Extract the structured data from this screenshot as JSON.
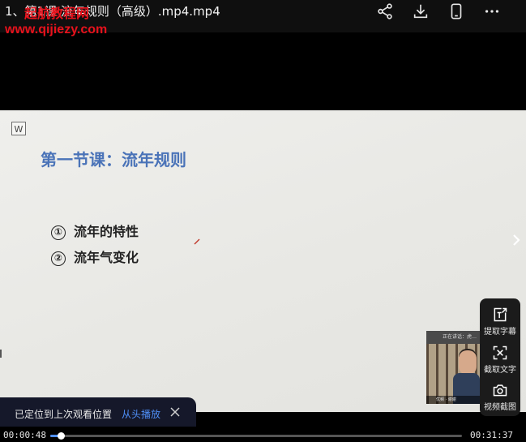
{
  "header": {
    "title": "1、第1课 流年规则（高级）.mp4.mp4",
    "watermark_text": "起航教程网",
    "watermark_url": "www.qijiezy.com",
    "actions": [
      {
        "icon": "share-icon"
      },
      {
        "icon": "download-icon"
      },
      {
        "icon": "phone-icon"
      },
      {
        "icon": "more-icon"
      }
    ]
  },
  "slide": {
    "logo_letter": "W",
    "title": "第一节课：流年规则",
    "points": [
      {
        "num": "①",
        "text": "流年的特性"
      },
      {
        "num": "②",
        "text": "流年气变化"
      }
    ]
  },
  "tools": [
    {
      "icon": "extract-subtitle-icon",
      "label": "提取字幕"
    },
    {
      "icon": "capture-text-icon",
      "label": "截取文字"
    },
    {
      "icon": "camera-icon",
      "label": "视频截图"
    }
  ],
  "webcam": {
    "header_text": "正在讲话：虎…",
    "footer_text": "优频 · 谢谢"
  },
  "toast": {
    "message": "已定位到上次观看位置",
    "action": "从头播放"
  },
  "player": {
    "current_time": "00:00:48",
    "duration": "00:31:37",
    "progress_fraction": 0.0253
  },
  "colors": {
    "watermark": "#e8121c",
    "slide_title": "#4a73b8",
    "accent": "#4f8ff7"
  }
}
